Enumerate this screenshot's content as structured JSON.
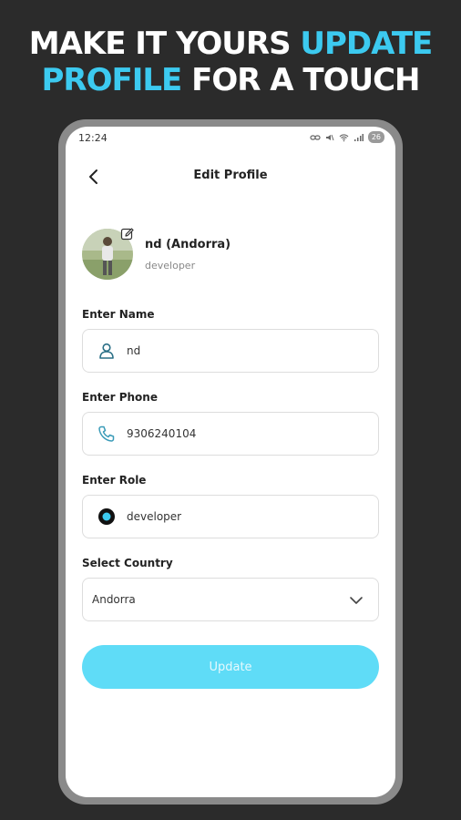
{
  "headline": {
    "line1_white": "MAKE IT YOURS ",
    "line1_accent": "UPDATE",
    "line2_accent": "PROFILE",
    "line2_white": " FOR A TOUCH"
  },
  "status_bar": {
    "time": "12:24",
    "battery": "26"
  },
  "header": {
    "title": "Edit Profile"
  },
  "profile": {
    "name": "nd (Andorra)",
    "role": "developer"
  },
  "form": {
    "name_label": "Enter Name",
    "name_value": "nd",
    "phone_label": "Enter Phone",
    "phone_value": "9306240104",
    "role_label": "Enter Role",
    "role_value": "developer",
    "country_label": "Select Country",
    "country_value": "Andorra"
  },
  "actions": {
    "update_label": "Update"
  },
  "colors": {
    "accent": "#3ccaf0",
    "button": "#5fdcf7",
    "background": "#2b2b2b"
  }
}
